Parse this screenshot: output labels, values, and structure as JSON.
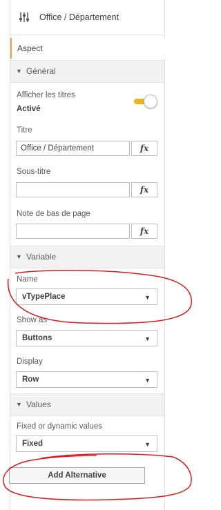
{
  "header": {
    "title": "Office / Département",
    "icon": "sliders-icon"
  },
  "tab": {
    "label": "Aspect"
  },
  "general": {
    "section_title": "Général",
    "show_titles_label": "Afficher les titres",
    "show_titles_value": "Activé",
    "show_titles_on": true,
    "title_label": "Titre",
    "title_value": "Office / Département",
    "subtitle_label": "Sous-titre",
    "subtitle_value": "",
    "footnote_label": "Note de bas de page",
    "footnote_value": "",
    "fx_label": "fx"
  },
  "variable": {
    "section_title": "Variable",
    "name_label": "Name",
    "name_value": "vTypePlace",
    "show_as_label": "Show as",
    "show_as_value": "Buttons",
    "display_label": "Display",
    "display_value": "Row"
  },
  "values": {
    "section_title": "Values",
    "fixed_dynamic_label": "Fixed or dynamic values",
    "fixed_dynamic_value": "Fixed",
    "add_button_label": "Add Alternative"
  },
  "colors": {
    "accent": "#f2a23a",
    "toggle_on": "#f0b21e",
    "annotation": "#d91a1a"
  }
}
